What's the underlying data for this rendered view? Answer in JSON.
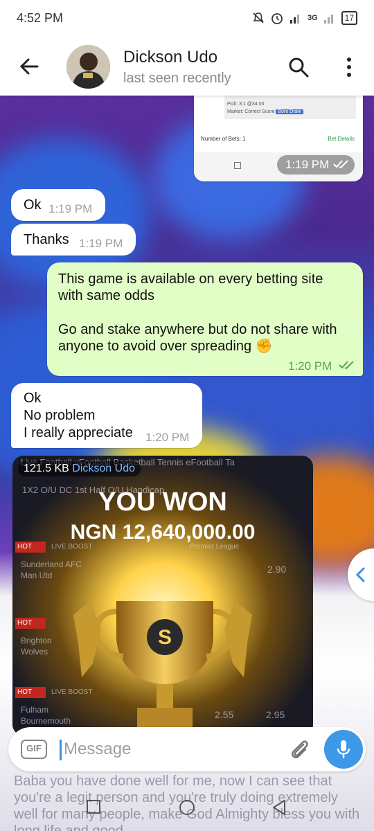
{
  "status_bar": {
    "time": "4:52 PM",
    "network": "3G",
    "battery": "17"
  },
  "header": {
    "name": "Dickson Udo",
    "status": "last seen recently"
  },
  "screenshot_card": {
    "pick": "Pick:  3:1 @34.00",
    "market": "Market:  Correct Score",
    "market_chip": "Bore Draw",
    "bets": "Number of Bets: 1",
    "details": "Bet Details",
    "time": "1:19 PM"
  },
  "messages": [
    {
      "direction": "in",
      "text": "Ok",
      "time": "1:19 PM"
    },
    {
      "direction": "in",
      "text": "Thanks",
      "time": "1:19 PM"
    },
    {
      "direction": "out",
      "line1": "This game is available on every betting site with same odds",
      "line2": "Go and stake anywhere but do not share with anyone to avoid over spreading ✊",
      "time": "1:20 PM"
    },
    {
      "direction": "in",
      "line1": "Ok",
      "line2": "No problem",
      "line3": "I really appreciate",
      "time": "1:20 PM"
    }
  ],
  "media": {
    "size": "121.5 KB",
    "sender": "Dickson Udo",
    "title": "YOU WON",
    "amount": "NGN 12,640,000.00",
    "bg_tabs": "Live  Football  vFootball  Basketball  Tennis  eFootball  Ta",
    "bg_markets": "1X2    O/U    DC    1st Half O/U    Handicap",
    "hot": "HOT",
    "live_boost": "LIVE BOOST",
    "league": "Premier League",
    "teams1": "Sunderland AFC",
    "teams1b": "Man Utd",
    "teams2": "Brighton",
    "teams2b": "Wolves",
    "teams3": "Fulham",
    "teams3b": "Bournemouth",
    "odd1": "2.90",
    "odd2": "2.55",
    "odd3": "2.95"
  },
  "input": {
    "placeholder": "Message",
    "gif": "GIF"
  },
  "background_message": "Baba you have done well for me, now I can see that you're a legit person and you're truly doing extremely well for many people, make God Almighty bless you with long life and good"
}
